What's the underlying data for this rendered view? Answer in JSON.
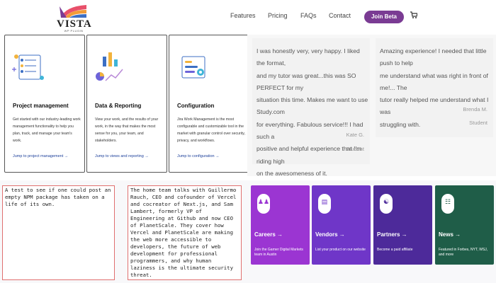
{
  "header": {
    "logo": {
      "word": "VISTA",
      "sub": "WP PLUGIN"
    },
    "nav": [
      "Features",
      "Pricing",
      "FAQs",
      "Contact"
    ],
    "cta": "Join Beta",
    "cart_icon": "cart-icon"
  },
  "features": [
    {
      "title": "Project management",
      "desc": "Get started with our industry-leading work management functionality to help you plan, track, and manage your team's work.",
      "link": "Jump to project management →",
      "icon": "project-management-illustration"
    },
    {
      "title": "Data & Reporting",
      "desc": "View your work, and the results of your work, in the way that makes the most sense for you, your team, and stakeholders.",
      "link": "Jump to views and reporting →",
      "icon": "data-reporting-illustration"
    },
    {
      "title": "Configuration",
      "desc": "Jira Work Management is the most configurable and customizable tool in the market with granular control over security, privacy, and workflows.",
      "link": "Jump to configuration →",
      "icon": "configuration-illustration"
    }
  ],
  "testimonials": [
    {
      "lines": [
        "I was honestly very, very happy. I liked the format,",
        "and my tutor was great...this was SO PERFECT for my",
        "situation this time. Makes me want to use Study.com",
        "for everything. Fabulous service!!! I had such a",
        "positive and helpful experience that I'm riding high",
        "on the awesomeness of it."
      ],
      "name": "Kate G.",
      "role": "Student"
    },
    {
      "lines": [
        "Amazing experience! I needed that little push to help",
        "me understand what was right in front of me!... The",
        "tutor really helped me understand what I was",
        "struggling with."
      ],
      "name": "Brenda M.",
      "role": "Student"
    }
  ],
  "posts": [
    "A test to see if one could post an empty NPM package has taken on a life of its own.",
    "The home team talks with Guillermo Rauch, CEO and cofounder of Vercel and cocreator of Next.js, and Sam Lambert, formerly VP of Engineering at Github and now CEO of PlanetScale. They cover how Vercel and PlanetScale are making the web more accessible to developers, the future of web development for professional programmers, and why human laziness is the ultimate security threat."
  ],
  "tiles": [
    {
      "title": "Careers →",
      "desc": "Join the Garner Digital Markets team in Austin",
      "color": "#9b35d2",
      "icon": "careers-icon"
    },
    {
      "title": "Vendors →",
      "desc": "List your product on our website",
      "color": "#6f36c8",
      "icon": "vendors-icon"
    },
    {
      "title": "Partners →",
      "desc": "Become a paid affiliate",
      "color": "#4d2a9a",
      "icon": "partners-icon"
    },
    {
      "title": "News →",
      "desc": "Featured in Forbes, NYT, WSJ, and more",
      "color": "#1f5d48",
      "icon": "news-icon"
    }
  ],
  "colors": {
    "accent": "#7a3b93",
    "link": "#1c3f9a",
    "post_border": "#e07070"
  }
}
